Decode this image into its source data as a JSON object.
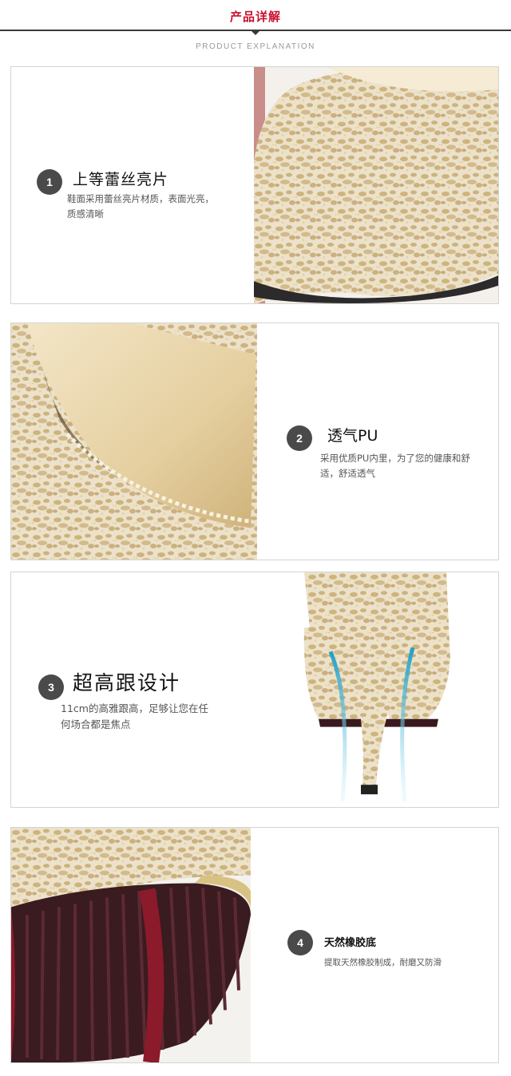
{
  "header": {
    "title": "产品详解",
    "subtitle": "PRODUCT EXPLANATION"
  },
  "features": [
    {
      "number": "1",
      "title": "上等蕾丝亮片",
      "description": "鞋面采用蕾丝亮片材质，表面光亮，质感清晰",
      "image_icon": "lace-toe-photo"
    },
    {
      "number": "2",
      "title": "透气PU",
      "description": "采用优质PU内里，为了您的健康和舒适，舒适透气",
      "image_icon": "shoe-lining-photo"
    },
    {
      "number": "3",
      "title": "超高跟设计",
      "description": "11cm的高雅跟高，足够让您在任何场合都是焦点",
      "image_icon": "high-heel-photo"
    },
    {
      "number": "4",
      "title": "天然橡胶底",
      "description": "提取天然橡胶制成，耐磨又防滑",
      "image_icon": "rubber-sole-photo"
    }
  ],
  "colors": {
    "accent": "#c8102e",
    "badge": "#4a4a4a",
    "lace_base": "#ede3cc",
    "lace_glitter": "#c8a96a",
    "sole": "#3a1a1e"
  }
}
